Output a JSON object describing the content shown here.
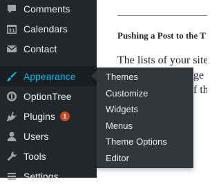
{
  "sidebar": {
    "items": [
      {
        "label": "Comments",
        "icon": "comment-icon"
      },
      {
        "label": "Calendars",
        "icon": "calendar-icon",
        "icon_text": "31"
      },
      {
        "label": "Contact",
        "icon": "envelope-icon"
      },
      {
        "label": "Appearance",
        "icon": "paintbrush-icon",
        "active": true
      },
      {
        "label": "OptionTree",
        "icon": "optiontree-icon"
      },
      {
        "label": "Plugins",
        "icon": "plugin-icon",
        "badge": "1"
      },
      {
        "label": "Users",
        "icon": "user-icon"
      },
      {
        "label": "Tools",
        "icon": "wrench-icon"
      },
      {
        "label": "Settings",
        "icon": "settings-icon"
      }
    ]
  },
  "flyout": {
    "items": [
      "Themes",
      "Customize",
      "Widgets",
      "Menus",
      "Theme Options",
      "Editor"
    ]
  },
  "content": {
    "heading": "Pushing a Post to the T",
    "para_lines": [
      "The lists of your site a",
      "ge th",
      "f th"
    ]
  },
  "colors": {
    "sidebar_bg": "#23282d",
    "flyout_bg": "#32373c",
    "active_text": "#00b9eb",
    "badge_bg": "#ca4a1f"
  }
}
